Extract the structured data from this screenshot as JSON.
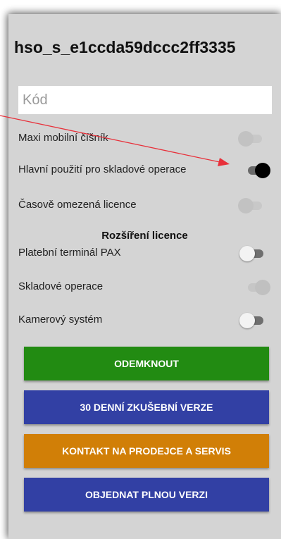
{
  "title": "hso_s_e1ccda59dccc2ff3335",
  "code_input": {
    "placeholder": "Kód",
    "value": ""
  },
  "licenses": [
    {
      "label": "Maxi mobilní číšník",
      "state": "off",
      "enabled": false
    },
    {
      "label": "Hlavní použití pro skladové operace",
      "state": "on",
      "enabled": true
    },
    {
      "label": "Časově omezená licence",
      "state": "off",
      "enabled": false
    }
  ],
  "extensions_heading": "Rozšíření licence",
  "extensions": [
    {
      "label": "Platební terminál PAX",
      "state": "off",
      "enabled": true
    },
    {
      "label": "Skladové operace",
      "state": "on",
      "enabled": false
    },
    {
      "label": "Kamerový systém",
      "state": "off",
      "enabled": true
    }
  ],
  "buttons": {
    "unlock": {
      "label": "ODEMKNOUT",
      "color": "#228b12"
    },
    "trial": {
      "label": "30 DENNÍ ZKUŠEBNÍ VERZE",
      "color": "#3240a4"
    },
    "contact": {
      "label": "KONTAKT NA PRODEJCE A SERVIS",
      "color": "#d17f07"
    },
    "order": {
      "label": "OBJEDNAT PLNOU VERZI",
      "color": "#3240a4"
    }
  },
  "annotation_arrow_color": "#e8303a"
}
